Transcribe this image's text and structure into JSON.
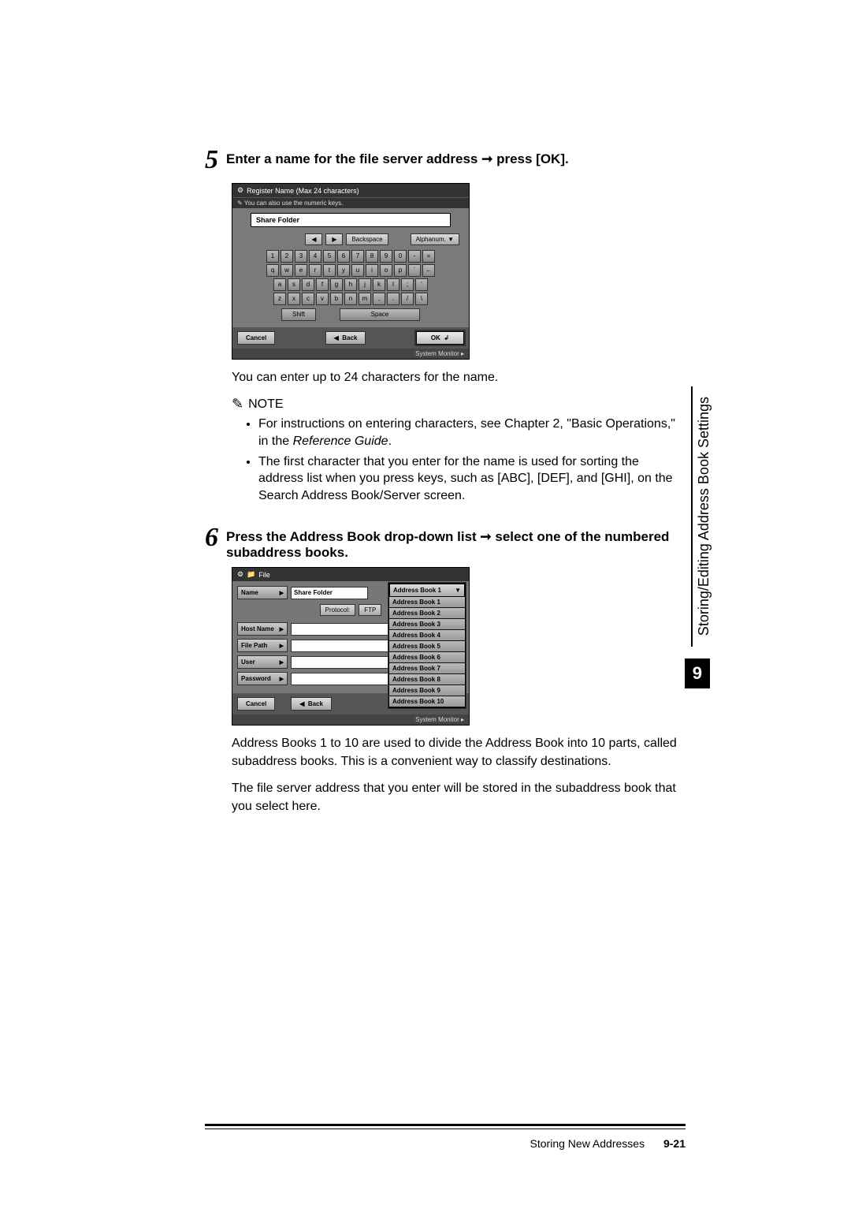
{
  "sidebar": {
    "label": "Storing/Editing Address Book Settings",
    "chapter": "9"
  },
  "step5": {
    "num": "5",
    "title_a": "Enter a name for the file server address ",
    "arrow": "➞",
    "title_b": " press [OK].",
    "caption": "You can enter up to 24 characters for the name.",
    "ss": {
      "title": "Register Name (Max 24 characters)",
      "subtitle": "You can also use the numeric keys.",
      "input_value": "Share Folder",
      "nav_left": "◀",
      "nav_right": "▶",
      "backspace": "Backspace",
      "mode": "Alphanum.",
      "mode_chev": "▼",
      "row1": [
        "1",
        "2",
        "3",
        "4",
        "5",
        "6",
        "7",
        "8",
        "9",
        "0",
        "-",
        "="
      ],
      "row2": [
        "q",
        "w",
        "e",
        "r",
        "t",
        "y",
        "u",
        "i",
        "o",
        "p",
        "`",
        "←"
      ],
      "row3": [
        "a",
        "s",
        "d",
        "f",
        "g",
        "h",
        "j",
        "k",
        "l",
        ";",
        "'"
      ],
      "row4": [
        "z",
        "x",
        "c",
        "v",
        "b",
        "n",
        "m",
        ",",
        ".",
        "/",
        "\\"
      ],
      "shift": "Shift",
      "space": "Space",
      "cancel": "Cancel",
      "back_arrow": "◀",
      "back": "Back",
      "ok": "OK",
      "ok_icon": "↲",
      "status": "System Monitor"
    }
  },
  "note": {
    "label": "NOTE",
    "items": [
      {
        "pre": "For instructions on entering characters, see Chapter 2, \"Basic Operations,\" in the ",
        "italic": "Reference Guide",
        "post": "."
      },
      {
        "pre": "The first character that you enter for the name is used for sorting the address list when you press keys, such as [ABC], [DEF], and [GHI], on the Search Address Book/Server screen.",
        "italic": "",
        "post": ""
      }
    ]
  },
  "step6": {
    "num": "6",
    "title_a": "Press the Address Book drop-down list ",
    "arrow": "➞",
    "title_b": " select one of the numbered subaddress books.",
    "ss": {
      "title_icon": "⚙",
      "title_tab": "File",
      "name_lbl": "Name",
      "name_val": "Share Folder",
      "proto_lbl": "Protocol:",
      "proto_val": "FTP",
      "host_lbl": "Host Name",
      "path_lbl": "File Path",
      "user_lbl": "User",
      "pass_lbl": "Password",
      "cancel": "Cancel",
      "back_arrow": "◀",
      "back": "Back",
      "status": "System Monitor",
      "dd_selected": "Address Book 1",
      "dd_chev": "▼",
      "dd_items": [
        "Address Book 1",
        "Address Book 2",
        "Address Book 3",
        "Address Book 4",
        "Address Book 5",
        "Address Book 6",
        "Address Book 7",
        "Address Book 8",
        "Address Book 9",
        "Address Book 10"
      ]
    },
    "para1": "Address Books 1 to 10 are used to divide the Address Book into 10 parts, called subaddress books. This is a convenient way to classify destinations.",
    "para2": "The file server address that you enter will be stored in the subaddress book that you select here."
  },
  "footer": {
    "section": "Storing New Addresses",
    "page": "9-21"
  }
}
